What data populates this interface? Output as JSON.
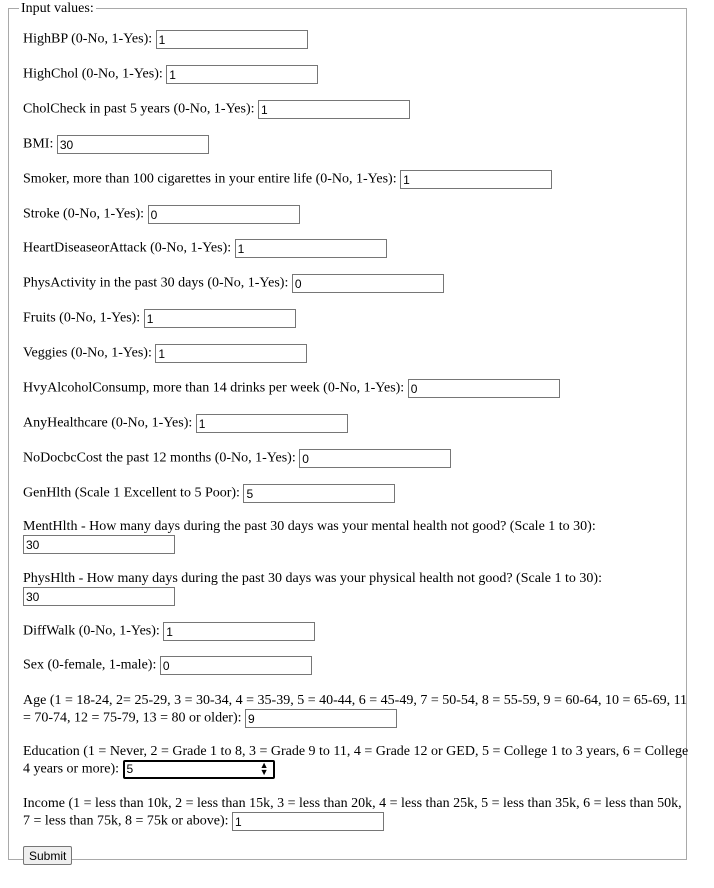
{
  "form": {
    "legend": "Input values:",
    "fields": [
      {
        "label": "HighBP (0-No, 1-Yes):",
        "value": "1"
      },
      {
        "label": "HighChol (0-No, 1-Yes):",
        "value": "1"
      },
      {
        "label": "CholCheck in past 5 years (0-No, 1-Yes):",
        "value": "1"
      },
      {
        "label": "BMI:",
        "value": "30"
      },
      {
        "label": "Smoker, more than 100 cigarettes in your entire life (0-No, 1-Yes):",
        "value": "1"
      },
      {
        "label": "Stroke (0-No, 1-Yes):",
        "value": "0"
      },
      {
        "label": "HeartDiseaseorAttack (0-No, 1-Yes):",
        "value": "1"
      },
      {
        "label": "PhysActivity in the past 30 days (0-No, 1-Yes):",
        "value": "0"
      },
      {
        "label": "Fruits (0-No, 1-Yes):",
        "value": "1"
      },
      {
        "label": "Veggies (0-No, 1-Yes):",
        "value": "1"
      },
      {
        "label": "HvyAlcoholConsump, more than 14 drinks per week (0-No, 1-Yes):",
        "value": "0"
      },
      {
        "label": "AnyHealthcare (0-No, 1-Yes):",
        "value": "1"
      },
      {
        "label": "NoDocbcCost the past 12 months (0-No, 1-Yes):",
        "value": "0"
      },
      {
        "label": "GenHlth (Scale 1 Excellent to 5 Poor):",
        "value": "5"
      },
      {
        "label": "MentHlth - How many days during the past 30 days was your mental health not good? (Scale 1 to 30):",
        "value": "30"
      },
      {
        "label": "PhysHlth - How many days during the past 30 days was your physical health not good? (Scale 1 to 30):",
        "value": "30"
      },
      {
        "label": "DiffWalk (0-No, 1-Yes):",
        "value": "1"
      },
      {
        "label": "Sex (0-female, 1-male):",
        "value": "0"
      },
      {
        "label": "Age (1 = 18-24, 2= 25-29, 3 = 30-34, 4 = 35-39, 5 = 40-44, 6 = 45-49, 7 = 50-54, 8 = 55-59, 9 = 60-64, 10 = 65-69, 11 = 70-74, 12 = 75-79, 13 = 80 or older):",
        "value": "9"
      },
      {
        "label": "Education (1 = Never, 2 = Grade 1 to 8, 3 = Grade 9 to 11, 4 = Grade 12 or GED, 5 = College 1 to 3 years, 6 = College 4 years or more):",
        "value": "5"
      },
      {
        "label": "Income (1 = less than 10k, 2 = less than 15k, 3 = less than 20k, 4 = less than 25k, 5 = less than 35k, 6 = less than 50k, 7 = less than 75k, 8 = 75k or above):",
        "value": "1"
      }
    ],
    "submit_label": "Submit"
  }
}
